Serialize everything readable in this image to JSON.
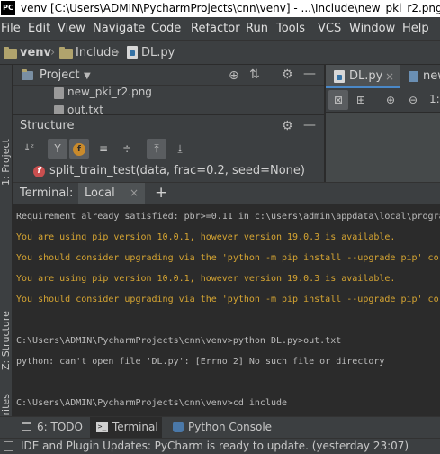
{
  "window": {
    "title": "venv [C:\\Users\\ADMIN\\PycharmProjects\\cnn\\venv] - ...\\Include\\new_pki_r2.png [v",
    "app_icon_text": "PC"
  },
  "menu": {
    "items": [
      "File",
      "Edit",
      "View",
      "Navigate",
      "Code",
      "Refactor",
      "Run",
      "Tools",
      "VCS",
      "Window",
      "Help"
    ]
  },
  "breadcrumb": {
    "items": [
      "venv",
      "Include",
      "DL.py"
    ]
  },
  "left_strip": {
    "tabs": [
      "1: Project",
      "Z: Structure",
      "2: Favorites"
    ]
  },
  "project_panel": {
    "title": "Project",
    "files": [
      "new_pki_r2.png",
      "out.txt"
    ]
  },
  "structure_panel": {
    "title": "Structure",
    "item": "split_train_test(data, frac=0.2, seed=None)"
  },
  "editor": {
    "tabs": [
      "DL.py",
      "new"
    ],
    "zoom_label": "1:"
  },
  "terminal": {
    "title": "Terminal:",
    "tab": "Local",
    "lines": [
      {
        "text": "Requirement already satisfied: pbr>=0.11 in c:\\users\\admin\\appdata\\local\\progra",
        "color": "#bbbbbb"
      },
      {
        "text": "You are using pip version 10.0.1, however version 19.0.3 is available.",
        "color": "#d6a532"
      },
      {
        "text": "You should consider upgrading via the 'python -m pip install --upgrade pip' co",
        "color": "#d6a532"
      },
      {
        "text": "You are using pip version 10.0.1, however version 19.0.3 is available.",
        "color": "#d6a532"
      },
      {
        "text": "You should consider upgrading via the 'python -m pip install --upgrade pip' co",
        "color": "#d6a532"
      },
      {
        "text": "",
        "color": "#bbbbbb"
      },
      {
        "text": "C:\\Users\\ADMIN\\PycharmProjects\\cnn\\venv>python DL.py>out.txt",
        "color": "#bbbbbb"
      },
      {
        "text": "python: can't open file 'DL.py': [Errno 2] No such file or directory",
        "color": "#bbbbbb"
      },
      {
        "text": "",
        "color": "#bbbbbb"
      },
      {
        "text": "C:\\Users\\ADMIN\\PycharmProjects\\cnn\\venv>cd include",
        "color": "#bbbbbb"
      }
    ]
  },
  "bottom_tabs": {
    "todo": "6: TODO",
    "terminal": "Terminal",
    "python_console": "Python Console"
  },
  "status": {
    "text": "IDE and Plugin Updates: PyCharm is ready to update. (yesterday 23:07)"
  },
  "colors": {
    "accent": "#4a88c7",
    "warning_text": "#d6a532"
  }
}
